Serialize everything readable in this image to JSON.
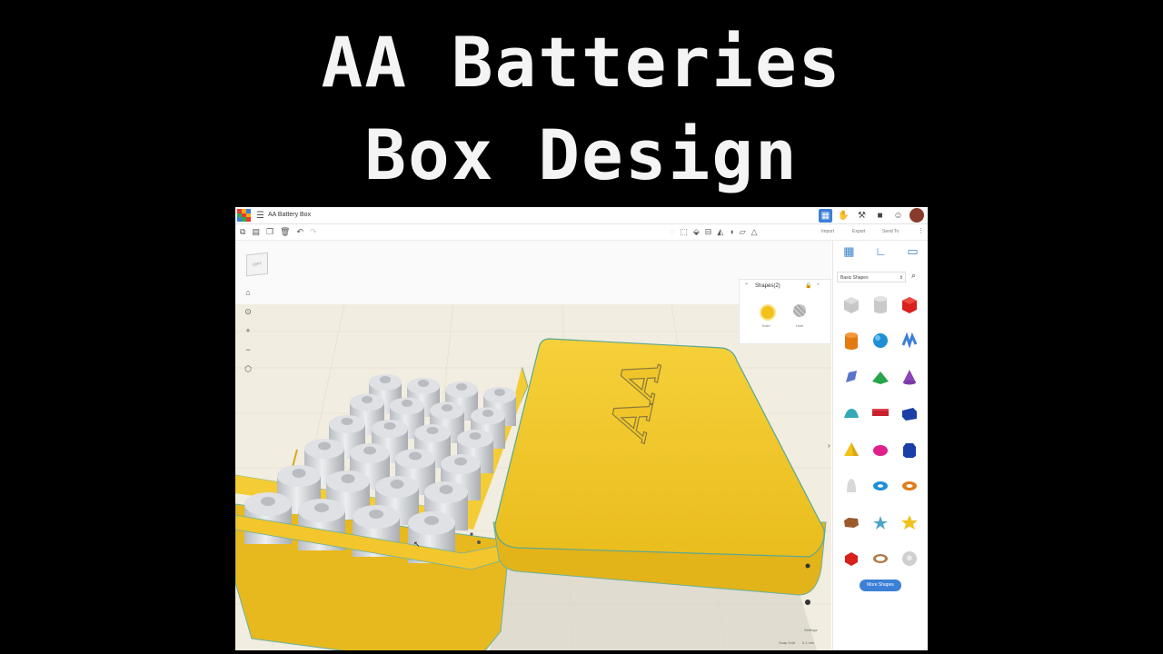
{
  "headline": {
    "line1": "AA Batteries",
    "line2": "Box Design"
  },
  "app": {
    "doc_title": "AA Battery Box",
    "toolbar": {
      "import": "Import",
      "export": "Export",
      "send_to": "Send To"
    },
    "viewcube_label": "LEFT",
    "inspector": {
      "title": "Shapes(2)",
      "solid": "Solid",
      "hole": "Hole",
      "solid_color": "#f2c21b",
      "hole_color": "#a8a8a8"
    },
    "library": {
      "selected": "Basic Shapes",
      "more_button": "More Shapes"
    },
    "bottom": {
      "settings": "Settings",
      "snap_grid": "Snap Grid",
      "snap_value": "0.1 mm"
    },
    "lid_text": "AA",
    "colors": {
      "accent": "#3c7fd6",
      "box_yellow": "#f2c21b"
    }
  }
}
